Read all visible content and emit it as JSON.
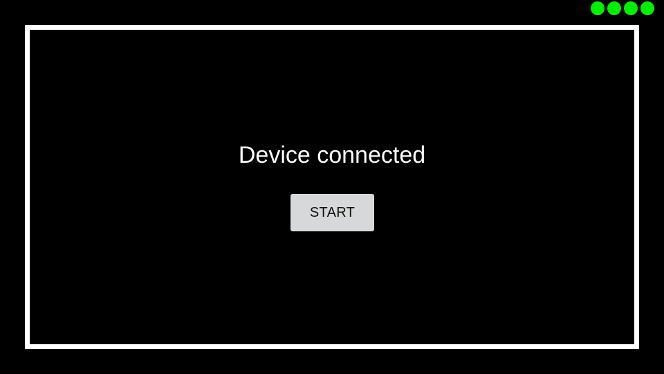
{
  "status": {
    "indicator_color": "#00ee00",
    "dots": [
      "status-dot",
      "status-dot",
      "status-dot",
      "status-dot"
    ]
  },
  "main": {
    "message": "Device connected",
    "start_label": "START"
  },
  "colors": {
    "background": "#000000",
    "frame": "#ffffff",
    "button_bg": "#d7d8d9"
  }
}
